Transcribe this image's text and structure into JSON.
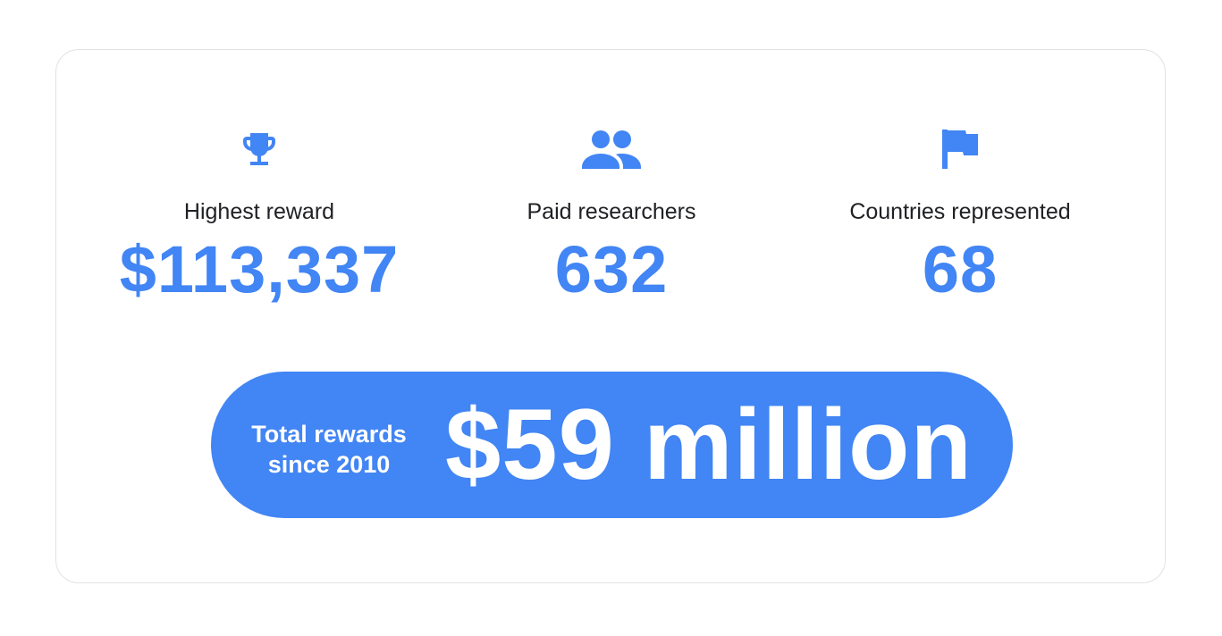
{
  "stats": [
    {
      "icon": "trophy-icon",
      "label": "Highest reward",
      "value": "$113,337"
    },
    {
      "icon": "people-icon",
      "label": "Paid researchers",
      "value": "632"
    },
    {
      "icon": "flag-icon",
      "label": "Countries represented",
      "value": "68"
    }
  ],
  "total": {
    "caption_line1": "Total rewards",
    "caption_line2": "since 2010",
    "amount": "$59 million"
  },
  "colors": {
    "accent": "#4285f4",
    "text": "#202124",
    "card_border": "#e2e2e2"
  }
}
